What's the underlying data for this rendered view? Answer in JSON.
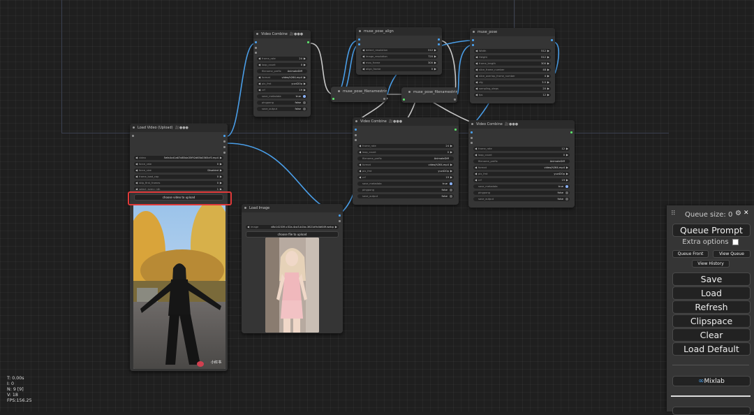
{
  "stats": {
    "t": "T: 0.00s",
    "i": "I: 0",
    "n": "N: 9 [9]",
    "v": "V: 18",
    "fps": "FPS:156.25"
  },
  "nodes": {
    "video_combine_top": {
      "title": "Video Combine",
      "badge": "🎥●●●",
      "widgets": [
        {
          "label": "frame_rate",
          "value": "24"
        },
        {
          "label": "loop_count",
          "value": "0"
        },
        {
          "label": "filename_prefix",
          "value": "AnimateDiff"
        },
        {
          "label": "format",
          "value": "video/h264-mp4"
        },
        {
          "label": "pix_fmt",
          "value": "yuv420p"
        },
        {
          "label": "crf",
          "value": "19"
        },
        {
          "label": "save_metadata",
          "value": "true"
        },
        {
          "label": "pingpong",
          "value": "false"
        },
        {
          "label": "save_output",
          "value": "false"
        }
      ]
    },
    "muse_pose_align": {
      "title": "muse_pose_align",
      "widgets": [
        {
          "label": "detect_resolution",
          "value": "512"
        },
        {
          "label": "image_resolution",
          "value": "720"
        },
        {
          "label": "max_frame",
          "value": "300"
        },
        {
          "label": "align_frame",
          "value": "0"
        }
      ]
    },
    "muse_pose": {
      "title": "muse_pose",
      "widgets": [
        {
          "label": "Width",
          "value": "512"
        },
        {
          "label": "Height",
          "value": "512"
        },
        {
          "label": "frame_length",
          "value": "300"
        },
        {
          "label": "slice_frame_number",
          "value": "48"
        },
        {
          "label": "slice_overlap_frame_number",
          "value": "4"
        },
        {
          "label": "cfg",
          "value": "3.5"
        },
        {
          "label": "sampling_steps",
          "value": "20"
        },
        {
          "label": "fps",
          "value": "12"
        }
      ]
    },
    "fn_string_1": {
      "title": "muse_pose_filenamestring"
    },
    "fn_string_2": {
      "title": "muse_pose_filenamestring"
    },
    "load_video": {
      "title": "Load Video (Upload)",
      "badge": "🎥●●●",
      "widgets": [
        {
          "label": "video",
          "value": "5efa4cd1a67d85da35f92d65b0365cf0.mp4"
        },
        {
          "label": "force_rate",
          "value": "0"
        },
        {
          "label": "force_size",
          "value": "Disabled"
        },
        {
          "label": "frame_load_cap",
          "value": "0"
        },
        {
          "label": "skip_first_frames",
          "value": "0"
        },
        {
          "label": "select_every_nth",
          "value": "1"
        }
      ],
      "upload_button": "choose video to upload",
      "watermark": "小红书"
    },
    "load_image": {
      "title": "Load Image",
      "widgets": [
        {
          "label": "image",
          "value": "d8c142339-c32a-4ca3-b1bc-3621d9c0d649.webp"
        }
      ],
      "upload_button": "choose file to upload"
    },
    "video_combine_mid": {
      "title": "Video Combine",
      "badge": "🎥●●●",
      "widgets": [
        {
          "label": "frame_rate",
          "value": "24"
        },
        {
          "label": "loop_count",
          "value": "0"
        },
        {
          "label": "filename_prefix",
          "value": "AnimateDiff"
        },
        {
          "label": "format",
          "value": "video/h264-mp4"
        },
        {
          "label": "pix_fmt",
          "value": "yuv420p"
        },
        {
          "label": "crf",
          "value": "19"
        },
        {
          "label": "save_metadata",
          "value": "true"
        },
        {
          "label": "pingpong",
          "value": "false"
        },
        {
          "label": "save_output",
          "value": "false"
        }
      ]
    },
    "video_combine_right": {
      "title": "Video Combine",
      "badge": "🎥●●●",
      "widgets": [
        {
          "label": "frame_rate",
          "value": "12"
        },
        {
          "label": "loop_count",
          "value": "0"
        },
        {
          "label": "filename_prefix",
          "value": "AnimateDiff"
        },
        {
          "label": "format",
          "value": "video/h264-mp4"
        },
        {
          "label": "pix_fmt",
          "value": "yuv420p"
        },
        {
          "label": "crf",
          "value": "19"
        },
        {
          "label": "save_metadata",
          "value": "true"
        },
        {
          "label": "pingpong",
          "value": "false"
        },
        {
          "label": "save_output",
          "value": "false"
        }
      ]
    }
  },
  "panel": {
    "queue_size": "Queue size: 0",
    "queue_prompt": "Queue Prompt",
    "extra_options": "Extra options",
    "queue_front": "Queue Front",
    "view_queue": "View Queue",
    "view_history": "View History",
    "save": "Save",
    "load": "Load",
    "refresh": "Refresh",
    "clipspace": "Clipspace",
    "clear": "Clear",
    "load_default": "Load Default",
    "mixlab": "Mixlab",
    "mixlab_icon": "∞",
    "settings_icon": "⚙",
    "close_icon": "✕",
    "drag_icon": "⠿"
  },
  "colors": {
    "highlight": "#e03a3a",
    "link": "#4a9ee8",
    "image_link": "#5be06a"
  }
}
